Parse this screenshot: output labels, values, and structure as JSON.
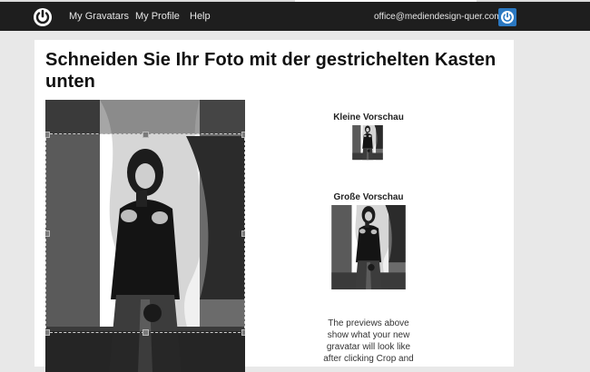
{
  "nav": {
    "items": [
      "My Gravatars",
      "My Profile",
      "Help"
    ],
    "email": "office@mediendesign-quer.com"
  },
  "page": {
    "title": "Schneiden Sie Ihr Foto mit der gestrichelten Kasten unten"
  },
  "previews": {
    "small_label": "Kleine Vorschau",
    "large_label": "Große Vorschau",
    "note": "The previews above show what your new gravatar will look like after clicking Crop and"
  },
  "colors": {
    "navbar": "#1e1e1e",
    "avatar_blue": "#2a78c2",
    "card": "#ffffff"
  },
  "icons": {
    "logo": "power-icon",
    "account": "power-icon"
  }
}
